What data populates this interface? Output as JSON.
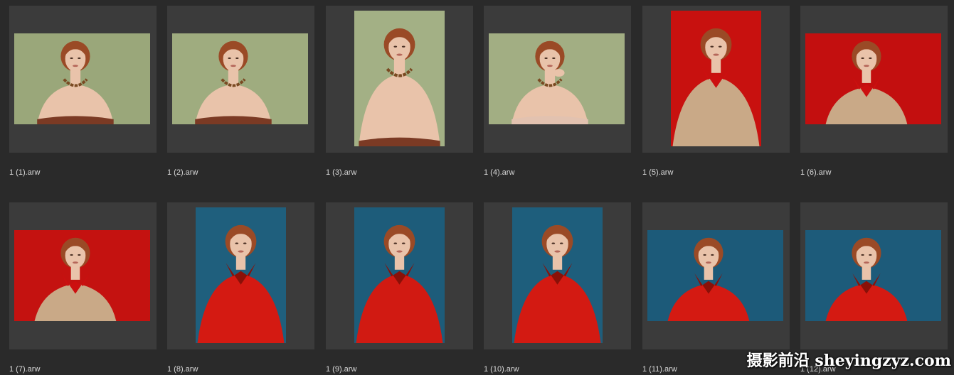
{
  "files": [
    {
      "name": "1 (1).arw",
      "orientation": "landscape",
      "background": "#9aa77a",
      "garment": "#7b3a24",
      "accent": "#6e3a18",
      "pose": "shoulder"
    },
    {
      "name": "1 (2).arw",
      "orientation": "landscape",
      "background": "#9fac7f",
      "garment": "#7b3a24",
      "accent": "#6e3a18",
      "pose": "front"
    },
    {
      "name": "1 (3).arw",
      "orientation": "portrait",
      "background": "#a3b085",
      "garment": "#7b3a24",
      "accent": "#6e3a18",
      "pose": "chin-up"
    },
    {
      "name": "1 (4).arw",
      "orientation": "landscape",
      "background": "#a2ae83",
      "garment": "#e2c2b0",
      "accent": "#b05a3a",
      "pose": "hand"
    },
    {
      "name": "1 (5).arw",
      "orientation": "portrait",
      "background": "#c8110f",
      "garment": "#c9a987",
      "accent": "#cc1010",
      "pose": "coat"
    },
    {
      "name": "1 (6).arw",
      "orientation": "landscape",
      "background": "#c30f0f",
      "garment": "#c9a987",
      "accent": "#cc1010",
      "pose": "coat"
    },
    {
      "name": "1 (7).arw",
      "orientation": "landscape",
      "background": "#c41210",
      "garment": "#c9a987",
      "accent": "#cc1010",
      "pose": "coat"
    },
    {
      "name": "1 (8).arw",
      "orientation": "portrait",
      "background": "#1f5f7d",
      "garment": "#d41a12",
      "accent": "#8a1008",
      "pose": "jacket"
    },
    {
      "name": "1 (9).arw",
      "orientation": "portrait",
      "background": "#1d5c7a",
      "garment": "#d11a12",
      "accent": "#8a1008",
      "pose": "jacket"
    },
    {
      "name": "1 (10).arw",
      "orientation": "portrait",
      "background": "#1e5e7c",
      "garment": "#d31a12",
      "accent": "#8a1008",
      "pose": "jacket"
    },
    {
      "name": "1 (11).arw",
      "orientation": "landscape",
      "background": "#1c5a79",
      "garment": "#d41a12",
      "accent": "#8a1008",
      "pose": "jacket"
    },
    {
      "name": "1 (12).arw",
      "orientation": "landscape",
      "background": "#1d5b7a",
      "garment": "#d41a12",
      "accent": "#8a1008",
      "pose": "jacket"
    }
  ],
  "watermark": {
    "text": "摄影前沿 sheyingzyz.com"
  },
  "colors": {
    "skin": "#e9c3aa",
    "hair": "#9a4a26",
    "frame": "#3b3b3b",
    "canvas": "#2a2a2a",
    "label": "#d8d8d8"
  }
}
